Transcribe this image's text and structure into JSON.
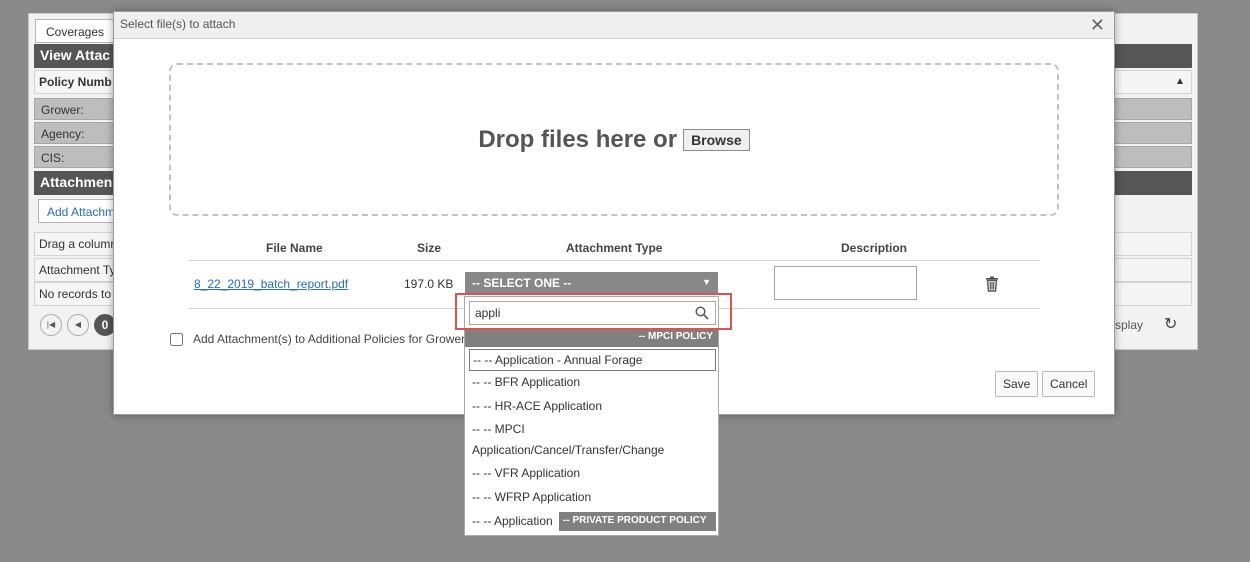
{
  "background": {
    "tab": "Coverages",
    "view_bar": "View Attac",
    "policy_row": "Policy Numb",
    "grower_label": "Grower:",
    "agency_label": "Agency:",
    "cis_label": "CIS:",
    "attachments_bar": "Attachmen",
    "add_attachment": "Add Attachm",
    "drag_text": "Drag a column",
    "attachment_type_col": "Attachment Ty",
    "no_records": "No records to",
    "page_number": "0",
    "display_text": "splay"
  },
  "modal": {
    "title": "Select file(s) to attach",
    "drop_text": "Drop files here or",
    "browse_label": "Browse",
    "columns": {
      "file_name": "File Name",
      "size": "Size",
      "attachment_type": "Attachment Type",
      "description": "Description"
    },
    "file": {
      "name": "8_22_2019_batch_report.pdf",
      "size": "197.0 KB",
      "type_select": "-- SELECT ONE --"
    },
    "additional_policies_label": "Add Attachment(s) to Additional Policies for Grower",
    "save_label": "Save",
    "cancel_label": "Cancel"
  },
  "dropdown": {
    "search_value": "appli",
    "group_mpci": "-- MPCI POLICY",
    "options": [
      "-- -- Application - Annual Forage",
      "-- -- BFR Application",
      "-- -- HR-ACE Application",
      "-- -- MPCI",
      "Application/Cancel/Transfer/Change",
      "-- -- VFR Application",
      "-- -- WFRP Application",
      "-- -- Application"
    ],
    "group_private": "-- PRIVATE PRODUCT POLICY"
  },
  "colors": {
    "accent_link": "#2a6ebb",
    "highlight": "#d9534f",
    "select_bg": "#888888"
  },
  "icons": {
    "close": "close-icon",
    "trash": "trash-icon",
    "search": "search-icon",
    "caret": "chevron-down-icon",
    "refresh": "refresh-icon"
  }
}
